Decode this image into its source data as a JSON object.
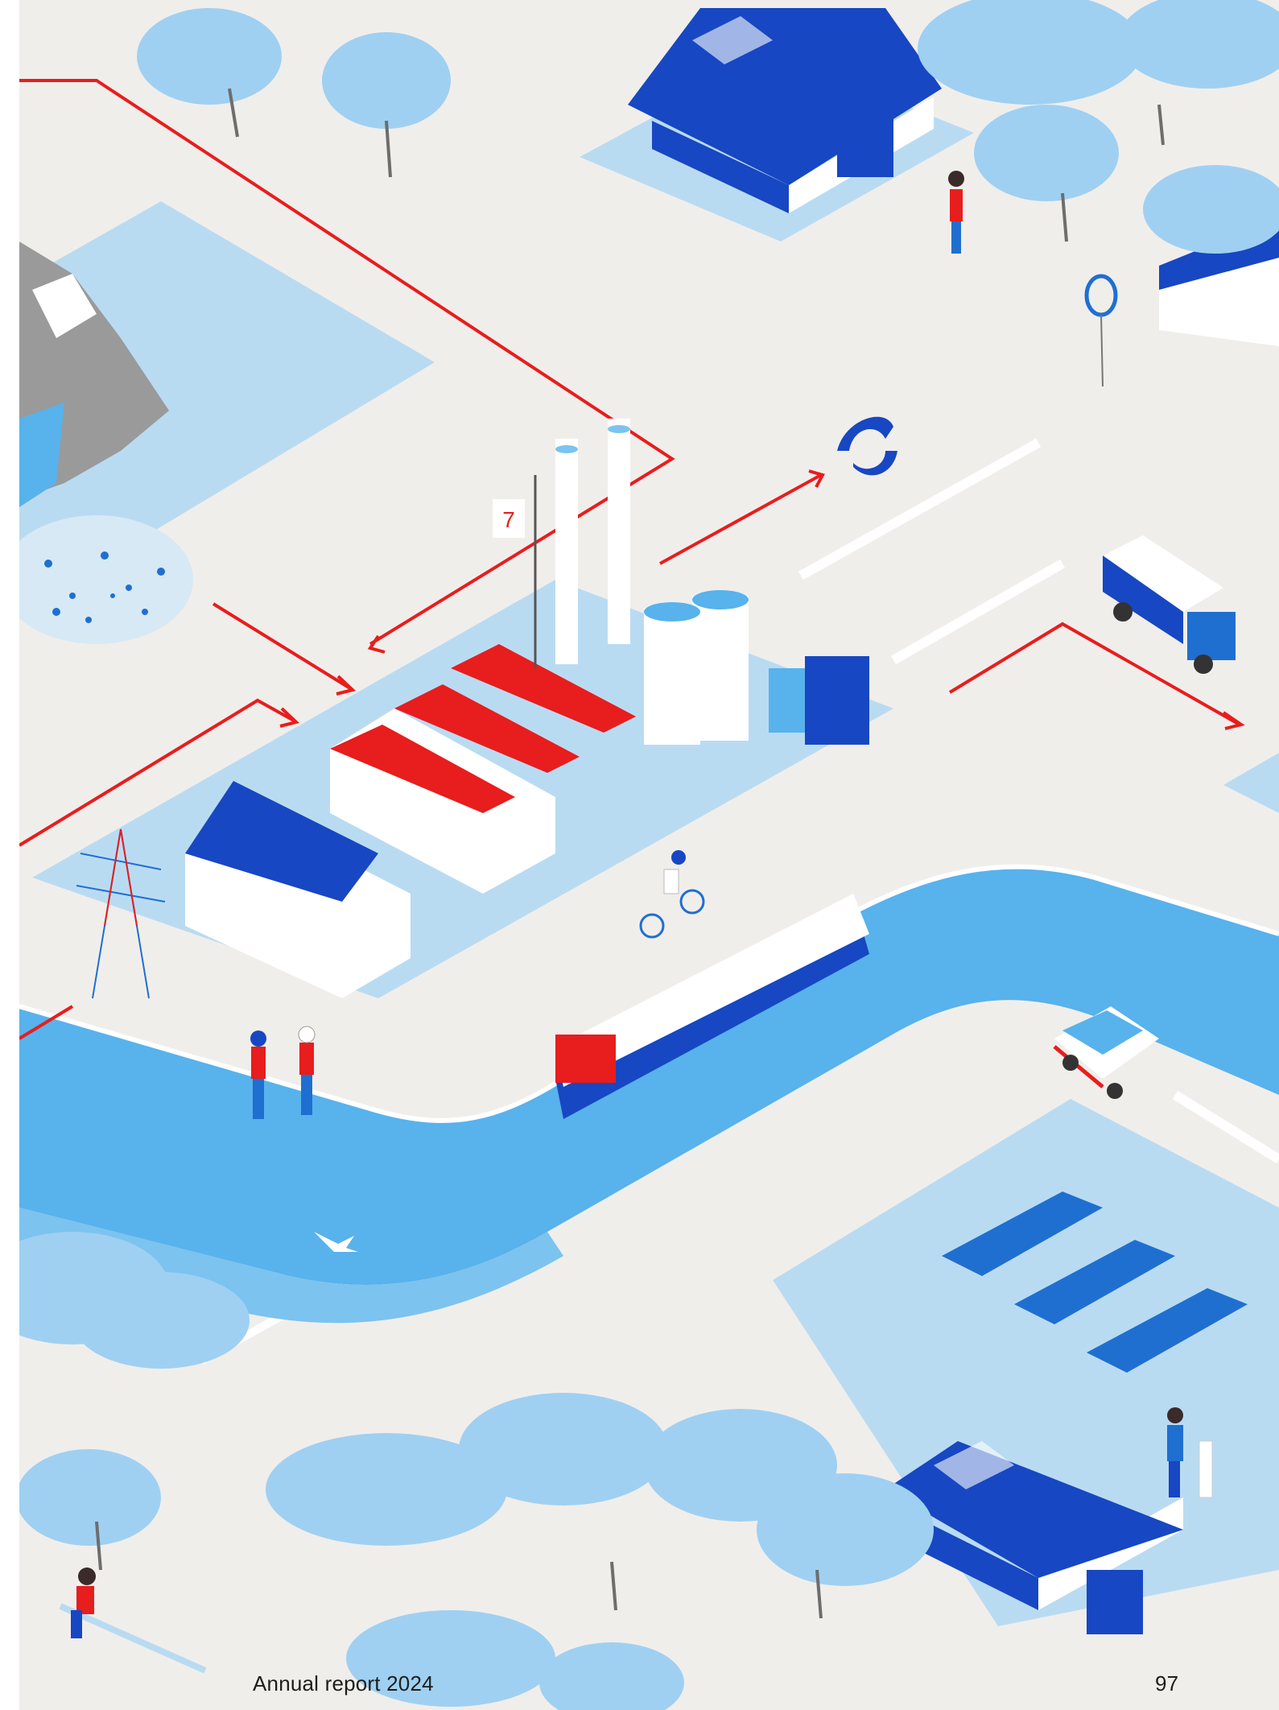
{
  "footer": {
    "title": "Annual report 2024",
    "page_number": "97"
  },
  "colors": {
    "ground": "#f0eeeb",
    "light_blue": "#b9dbf2",
    "mid_blue": "#7cc3ef",
    "water": "#58b2ec",
    "dark_blue": "#1747c2",
    "red": "#e81d1d",
    "grey_rock": "#9a9a9a"
  },
  "illustration": {
    "logo_sign_text": "7"
  }
}
